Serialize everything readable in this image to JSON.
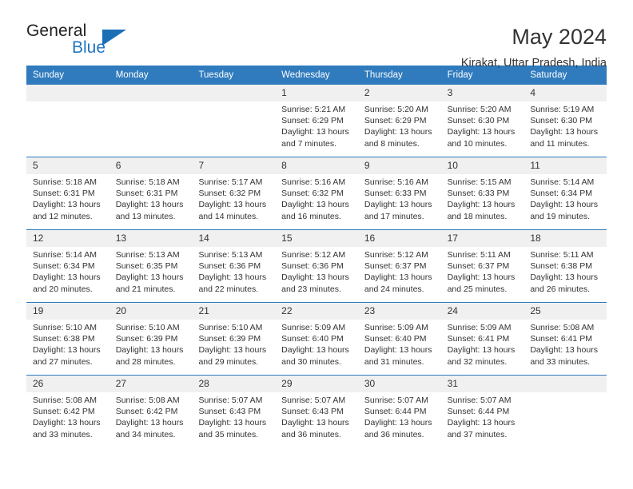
{
  "brand": {
    "name_top": "General",
    "name_bottom": "Blue",
    "accent": "#1f76c0",
    "triangle_color": "#1b6fb5"
  },
  "header": {
    "title": "May 2024",
    "location": "Kirakat, Uttar Pradesh, India"
  },
  "calendar": {
    "header_bg": "#2f7bbd",
    "datenum_bg": "#f0f0f0",
    "weekdays": [
      "Sunday",
      "Monday",
      "Tuesday",
      "Wednesday",
      "Thursday",
      "Friday",
      "Saturday"
    ],
    "weeks": [
      [
        {
          "day": "",
          "sunrise": "",
          "sunset": "",
          "daylight1": "",
          "daylight2": "",
          "empty": true
        },
        {
          "day": "",
          "sunrise": "",
          "sunset": "",
          "daylight1": "",
          "daylight2": "",
          "empty": true
        },
        {
          "day": "",
          "sunrise": "",
          "sunset": "",
          "daylight1": "",
          "daylight2": "",
          "empty": true
        },
        {
          "day": "1",
          "sunrise": "Sunrise: 5:21 AM",
          "sunset": "Sunset: 6:29 PM",
          "daylight1": "Daylight: 13 hours",
          "daylight2": "and 7 minutes.",
          "empty": false
        },
        {
          "day": "2",
          "sunrise": "Sunrise: 5:20 AM",
          "sunset": "Sunset: 6:29 PM",
          "daylight1": "Daylight: 13 hours",
          "daylight2": "and 8 minutes.",
          "empty": false
        },
        {
          "day": "3",
          "sunrise": "Sunrise: 5:20 AM",
          "sunset": "Sunset: 6:30 PM",
          "daylight1": "Daylight: 13 hours",
          "daylight2": "and 10 minutes.",
          "empty": false
        },
        {
          "day": "4",
          "sunrise": "Sunrise: 5:19 AM",
          "sunset": "Sunset: 6:30 PM",
          "daylight1": "Daylight: 13 hours",
          "daylight2": "and 11 minutes.",
          "empty": false
        }
      ],
      [
        {
          "day": "5",
          "sunrise": "Sunrise: 5:18 AM",
          "sunset": "Sunset: 6:31 PM",
          "daylight1": "Daylight: 13 hours",
          "daylight2": "and 12 minutes.",
          "empty": false
        },
        {
          "day": "6",
          "sunrise": "Sunrise: 5:18 AM",
          "sunset": "Sunset: 6:31 PM",
          "daylight1": "Daylight: 13 hours",
          "daylight2": "and 13 minutes.",
          "empty": false
        },
        {
          "day": "7",
          "sunrise": "Sunrise: 5:17 AM",
          "sunset": "Sunset: 6:32 PM",
          "daylight1": "Daylight: 13 hours",
          "daylight2": "and 14 minutes.",
          "empty": false
        },
        {
          "day": "8",
          "sunrise": "Sunrise: 5:16 AM",
          "sunset": "Sunset: 6:32 PM",
          "daylight1": "Daylight: 13 hours",
          "daylight2": "and 16 minutes.",
          "empty": false
        },
        {
          "day": "9",
          "sunrise": "Sunrise: 5:16 AM",
          "sunset": "Sunset: 6:33 PM",
          "daylight1": "Daylight: 13 hours",
          "daylight2": "and 17 minutes.",
          "empty": false
        },
        {
          "day": "10",
          "sunrise": "Sunrise: 5:15 AM",
          "sunset": "Sunset: 6:33 PM",
          "daylight1": "Daylight: 13 hours",
          "daylight2": "and 18 minutes.",
          "empty": false
        },
        {
          "day": "11",
          "sunrise": "Sunrise: 5:14 AM",
          "sunset": "Sunset: 6:34 PM",
          "daylight1": "Daylight: 13 hours",
          "daylight2": "and 19 minutes.",
          "empty": false
        }
      ],
      [
        {
          "day": "12",
          "sunrise": "Sunrise: 5:14 AM",
          "sunset": "Sunset: 6:34 PM",
          "daylight1": "Daylight: 13 hours",
          "daylight2": "and 20 minutes.",
          "empty": false
        },
        {
          "day": "13",
          "sunrise": "Sunrise: 5:13 AM",
          "sunset": "Sunset: 6:35 PM",
          "daylight1": "Daylight: 13 hours",
          "daylight2": "and 21 minutes.",
          "empty": false
        },
        {
          "day": "14",
          "sunrise": "Sunrise: 5:13 AM",
          "sunset": "Sunset: 6:36 PM",
          "daylight1": "Daylight: 13 hours",
          "daylight2": "and 22 minutes.",
          "empty": false
        },
        {
          "day": "15",
          "sunrise": "Sunrise: 5:12 AM",
          "sunset": "Sunset: 6:36 PM",
          "daylight1": "Daylight: 13 hours",
          "daylight2": "and 23 minutes.",
          "empty": false
        },
        {
          "day": "16",
          "sunrise": "Sunrise: 5:12 AM",
          "sunset": "Sunset: 6:37 PM",
          "daylight1": "Daylight: 13 hours",
          "daylight2": "and 24 minutes.",
          "empty": false
        },
        {
          "day": "17",
          "sunrise": "Sunrise: 5:11 AM",
          "sunset": "Sunset: 6:37 PM",
          "daylight1": "Daylight: 13 hours",
          "daylight2": "and 25 minutes.",
          "empty": false
        },
        {
          "day": "18",
          "sunrise": "Sunrise: 5:11 AM",
          "sunset": "Sunset: 6:38 PM",
          "daylight1": "Daylight: 13 hours",
          "daylight2": "and 26 minutes.",
          "empty": false
        }
      ],
      [
        {
          "day": "19",
          "sunrise": "Sunrise: 5:10 AM",
          "sunset": "Sunset: 6:38 PM",
          "daylight1": "Daylight: 13 hours",
          "daylight2": "and 27 minutes.",
          "empty": false
        },
        {
          "day": "20",
          "sunrise": "Sunrise: 5:10 AM",
          "sunset": "Sunset: 6:39 PM",
          "daylight1": "Daylight: 13 hours",
          "daylight2": "and 28 minutes.",
          "empty": false
        },
        {
          "day": "21",
          "sunrise": "Sunrise: 5:10 AM",
          "sunset": "Sunset: 6:39 PM",
          "daylight1": "Daylight: 13 hours",
          "daylight2": "and 29 minutes.",
          "empty": false
        },
        {
          "day": "22",
          "sunrise": "Sunrise: 5:09 AM",
          "sunset": "Sunset: 6:40 PM",
          "daylight1": "Daylight: 13 hours",
          "daylight2": "and 30 minutes.",
          "empty": false
        },
        {
          "day": "23",
          "sunrise": "Sunrise: 5:09 AM",
          "sunset": "Sunset: 6:40 PM",
          "daylight1": "Daylight: 13 hours",
          "daylight2": "and 31 minutes.",
          "empty": false
        },
        {
          "day": "24",
          "sunrise": "Sunrise: 5:09 AM",
          "sunset": "Sunset: 6:41 PM",
          "daylight1": "Daylight: 13 hours",
          "daylight2": "and 32 minutes.",
          "empty": false
        },
        {
          "day": "25",
          "sunrise": "Sunrise: 5:08 AM",
          "sunset": "Sunset: 6:41 PM",
          "daylight1": "Daylight: 13 hours",
          "daylight2": "and 33 minutes.",
          "empty": false
        }
      ],
      [
        {
          "day": "26",
          "sunrise": "Sunrise: 5:08 AM",
          "sunset": "Sunset: 6:42 PM",
          "daylight1": "Daylight: 13 hours",
          "daylight2": "and 33 minutes.",
          "empty": false
        },
        {
          "day": "27",
          "sunrise": "Sunrise: 5:08 AM",
          "sunset": "Sunset: 6:42 PM",
          "daylight1": "Daylight: 13 hours",
          "daylight2": "and 34 minutes.",
          "empty": false
        },
        {
          "day": "28",
          "sunrise": "Sunrise: 5:07 AM",
          "sunset": "Sunset: 6:43 PM",
          "daylight1": "Daylight: 13 hours",
          "daylight2": "and 35 minutes.",
          "empty": false
        },
        {
          "day": "29",
          "sunrise": "Sunrise: 5:07 AM",
          "sunset": "Sunset: 6:43 PM",
          "daylight1": "Daylight: 13 hours",
          "daylight2": "and 36 minutes.",
          "empty": false
        },
        {
          "day": "30",
          "sunrise": "Sunrise: 5:07 AM",
          "sunset": "Sunset: 6:44 PM",
          "daylight1": "Daylight: 13 hours",
          "daylight2": "and 36 minutes.",
          "empty": false
        },
        {
          "day": "31",
          "sunrise": "Sunrise: 5:07 AM",
          "sunset": "Sunset: 6:44 PM",
          "daylight1": "Daylight: 13 hours",
          "daylight2": "and 37 minutes.",
          "empty": false
        },
        {
          "day": "",
          "sunrise": "",
          "sunset": "",
          "daylight1": "",
          "daylight2": "",
          "empty": true
        }
      ]
    ]
  }
}
